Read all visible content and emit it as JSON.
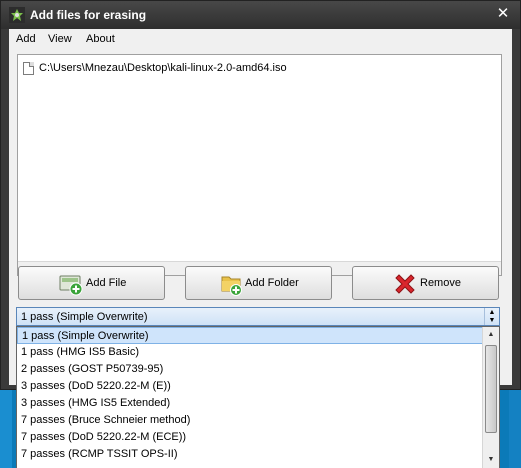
{
  "window": {
    "title": "Add files for erasing",
    "close_glyph": "✕",
    "icon": "app-leaf-icon"
  },
  "menu": [
    "Add",
    "View",
    "About"
  ],
  "files": [
    {
      "path": "C:\\Users\\Mnezau\\Desktop\\kali-linux-2.0-amd64.iso",
      "icon": "file-icon"
    }
  ],
  "buttons": {
    "add_file": {
      "label": "Add File",
      "icon": "add-file-icon"
    },
    "add_folder": {
      "label": "Add Folder",
      "icon": "add-folder-icon"
    },
    "remove": {
      "label": "Remove",
      "icon": "remove-x-icon"
    }
  },
  "erase_method": {
    "selected": "1 pass (Simple Overwrite)",
    "options": [
      "1 pass (Simple Overwrite)",
      "1 pass (HMG IS5 Basic)",
      "2 passes (GOST P50739-95)",
      "3 passes (DoD 5220.22-M (E))",
      "3 passes (HMG IS5 Extended)",
      "7 passes (Bruce Schneier method)",
      "7 passes (DoD 5220.22-M (ECE))",
      "7 passes (RCMP TSSIT OPS-II)"
    ],
    "highlighted_index": 0
  },
  "colors": {
    "titlebar": "#3a3a3a",
    "selection": "#cfe4fb",
    "remove_red": "#d9262d",
    "add_green": "#3aa43a"
  }
}
